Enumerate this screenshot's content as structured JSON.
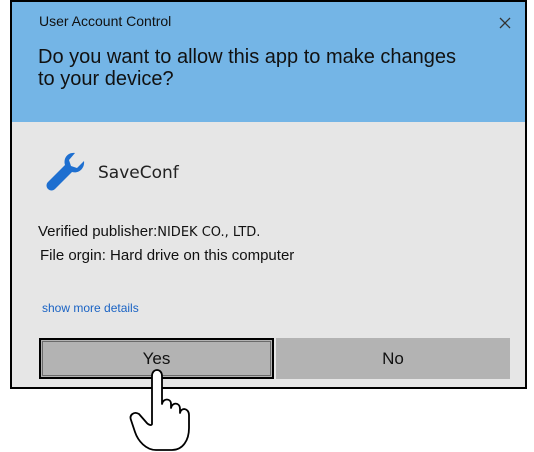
{
  "dialog": {
    "title": "User Account Control",
    "question": "Do you want to allow this app to make changes to your device?",
    "app_name": "SaveConf",
    "publisher_label": "Verified publisher:",
    "publisher_value": "NIDEK CO., LTD.",
    "origin_label": "File orgin:",
    "origin_value": "Hard drive on this computer",
    "more_details": "show more details",
    "yes_label": "Yes",
    "no_label": "No"
  },
  "icons": {
    "close": "close-icon",
    "app": "wrench-icon",
    "pointer": "pointing-hand-icon"
  },
  "colors": {
    "header_bg": "#74b5e6",
    "body_bg": "#e6e6e6",
    "button_bg": "#b3b3b3",
    "link": "#1a63c4",
    "app_icon": "#1e6fd0"
  }
}
